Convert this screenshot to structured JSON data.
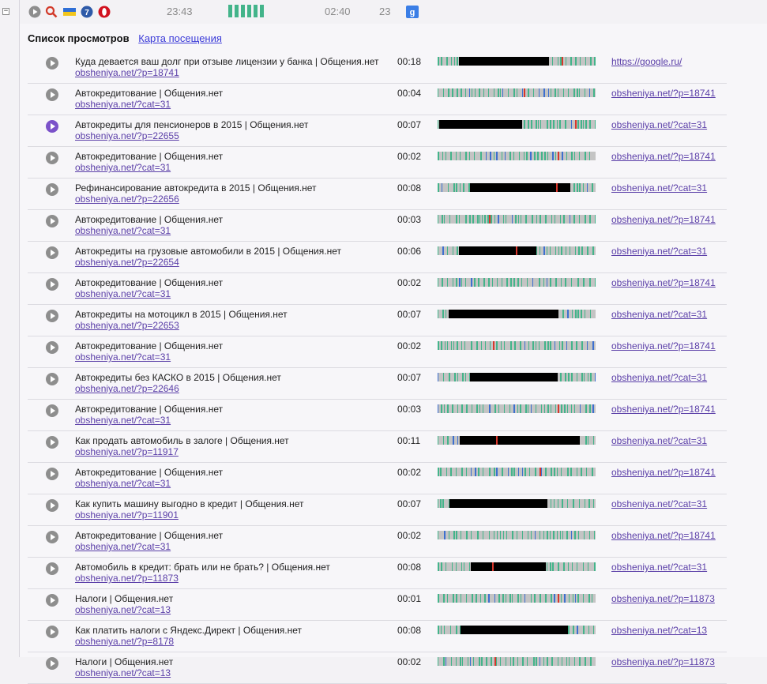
{
  "toolbar": {
    "clock_time": "23:43",
    "duration": "02:40",
    "count": "23"
  },
  "panel": {
    "title": "Список просмотров",
    "link": "Карта посещения"
  },
  "rows": [
    {
      "title": "Куда девается ваш долг при отзыве лицензии у банка | Общения.нет",
      "url": "obsheniya.net/?p=18741",
      "time": "00:18",
      "referrer": "https://google.ru/",
      "active": false
    },
    {
      "title": "Автокредитование | Общения.нет",
      "url": "obsheniya.net/?cat=31",
      "time": "00:04",
      "referrer": "obsheniya.net/?p=18741",
      "active": false
    },
    {
      "title": "Автокредиты для пенсионеров в 2015 | Общения.нет",
      "url": "obsheniya.net/?p=22655",
      "time": "00:07",
      "referrer": "obsheniya.net/?cat=31",
      "active": true
    },
    {
      "title": "Автокредитование | Общения.нет",
      "url": "obsheniya.net/?cat=31",
      "time": "00:02",
      "referrer": "obsheniya.net/?p=18741",
      "active": false
    },
    {
      "title": "Рефинансирование автокредита в 2015 | Общения.нет",
      "url": "obsheniya.net/?p=22656",
      "time": "00:08",
      "referrer": "obsheniya.net/?cat=31",
      "active": false
    },
    {
      "title": "Автокредитование | Общения.нет",
      "url": "obsheniya.net/?cat=31",
      "time": "00:03",
      "referrer": "obsheniya.net/?p=18741",
      "active": false
    },
    {
      "title": "Автокредиты на грузовые автомобили в 2015 | Общения.нет",
      "url": "obsheniya.net/?p=22654",
      "time": "00:06",
      "referrer": "obsheniya.net/?cat=31",
      "active": false
    },
    {
      "title": "Автокредитование | Общения.нет",
      "url": "obsheniya.net/?cat=31",
      "time": "00:02",
      "referrer": "obsheniya.net/?p=18741",
      "active": false
    },
    {
      "title": "Автокредиты на мотоцикл в 2015 | Общения.нет",
      "url": "obsheniya.net/?p=22653",
      "time": "00:07",
      "referrer": "obsheniya.net/?cat=31",
      "active": false
    },
    {
      "title": "Автокредитование | Общения.нет",
      "url": "obsheniya.net/?cat=31",
      "time": "00:02",
      "referrer": "obsheniya.net/?p=18741",
      "active": false
    },
    {
      "title": "Автокредиты без КАСКО в 2015 | Общения.нет",
      "url": "obsheniya.net/?p=22646",
      "time": "00:07",
      "referrer": "obsheniya.net/?cat=31",
      "active": false
    },
    {
      "title": "Автокредитование | Общения.нет",
      "url": "obsheniya.net/?cat=31",
      "time": "00:03",
      "referrer": "obsheniya.net/?p=18741",
      "active": false
    },
    {
      "title": "Как продать автомобиль в залоге | Общения.нет",
      "url": "obsheniya.net/?p=11917",
      "time": "00:11",
      "referrer": "obsheniya.net/?cat=31",
      "active": false
    },
    {
      "title": "Автокредитование | Общения.нет",
      "url": "obsheniya.net/?cat=31",
      "time": "00:02",
      "referrer": "obsheniya.net/?p=18741",
      "active": false
    },
    {
      "title": "Как купить машину выгодно в кредит | Общения.нет",
      "url": "obsheniya.net/?p=11901",
      "time": "00:07",
      "referrer": "obsheniya.net/?cat=31",
      "active": false
    },
    {
      "title": "Автокредитование | Общения.нет",
      "url": "obsheniya.net/?cat=31",
      "time": "00:02",
      "referrer": "obsheniya.net/?p=18741",
      "active": false
    },
    {
      "title": "Автомобиль в кредит: брать или не брать? | Общения.нет",
      "url": "obsheniya.net/?p=11873",
      "time": "00:08",
      "referrer": "obsheniya.net/?cat=31",
      "active": false
    },
    {
      "title": "Налоги | Общения.нет",
      "url": "obsheniya.net/?cat=13",
      "time": "00:01",
      "referrer": "obsheniya.net/?p=11873",
      "active": false
    },
    {
      "title": "Как платить налоги с Яндекс.Директ | Общения.нет",
      "url": "obsheniya.net/?p=8178",
      "time": "00:08",
      "referrer": "obsheniya.net/?cat=13",
      "active": false
    },
    {
      "title": "Налоги | Общения.нет",
      "url": "obsheniya.net/?cat=13",
      "time": "00:02",
      "referrer": "obsheniya.net/?p=11873",
      "active": false
    }
  ],
  "colors": {
    "activity_dark": "#000000",
    "activity_green": "#43b48a",
    "activity_red": "#d9362b",
    "activity_blue": "#3d6fd0",
    "track_bg": "#c4c4c4",
    "active_play": "#7b52c9"
  },
  "icons": [
    "play-icon",
    "search-icon",
    "flag-icon",
    "windows-icon",
    "opera-icon",
    "google-icon"
  ]
}
